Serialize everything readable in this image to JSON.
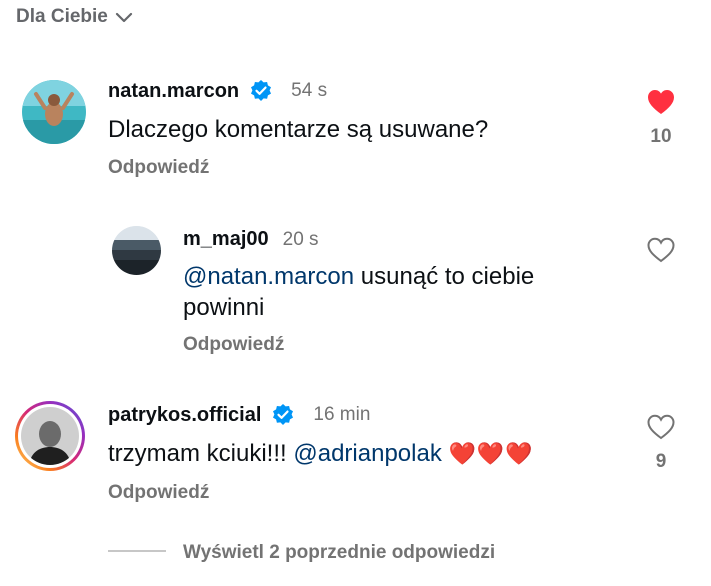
{
  "header": {
    "sort_label": "Dla Ciebie",
    "sort_icon": "chevron-down-icon"
  },
  "comments": [
    {
      "username": "natan.marcon",
      "verified": true,
      "time": "54 s",
      "text": "Dlaczego komentarze są usuwane?",
      "reply_label": "Odpowiedź",
      "liked": true,
      "like_count": "10"
    },
    {
      "username": "m_maj00",
      "verified": false,
      "time": "20 s",
      "mention": "@natan.marcon",
      "text_line1": "usunąć to ciebie",
      "text_line2": "powinni",
      "reply_label": "Odpowiedź",
      "liked": false
    },
    {
      "username": "patrykos.official",
      "verified": true,
      "time": "16 min",
      "text": "trzymam kciuki!!!",
      "mention": "@adrianpolak",
      "emoji": "❤️❤️❤️",
      "reply_label": "Odpowiedź",
      "liked": false,
      "like_count": "9"
    }
  ],
  "view_replies_label": "Wyświetl 2 poprzednie odpowiedzi",
  "colors": {
    "like_red": "#ff3040",
    "mention_blue": "#00376b",
    "verified_blue": "#0095f6",
    "muted": "#737373"
  }
}
